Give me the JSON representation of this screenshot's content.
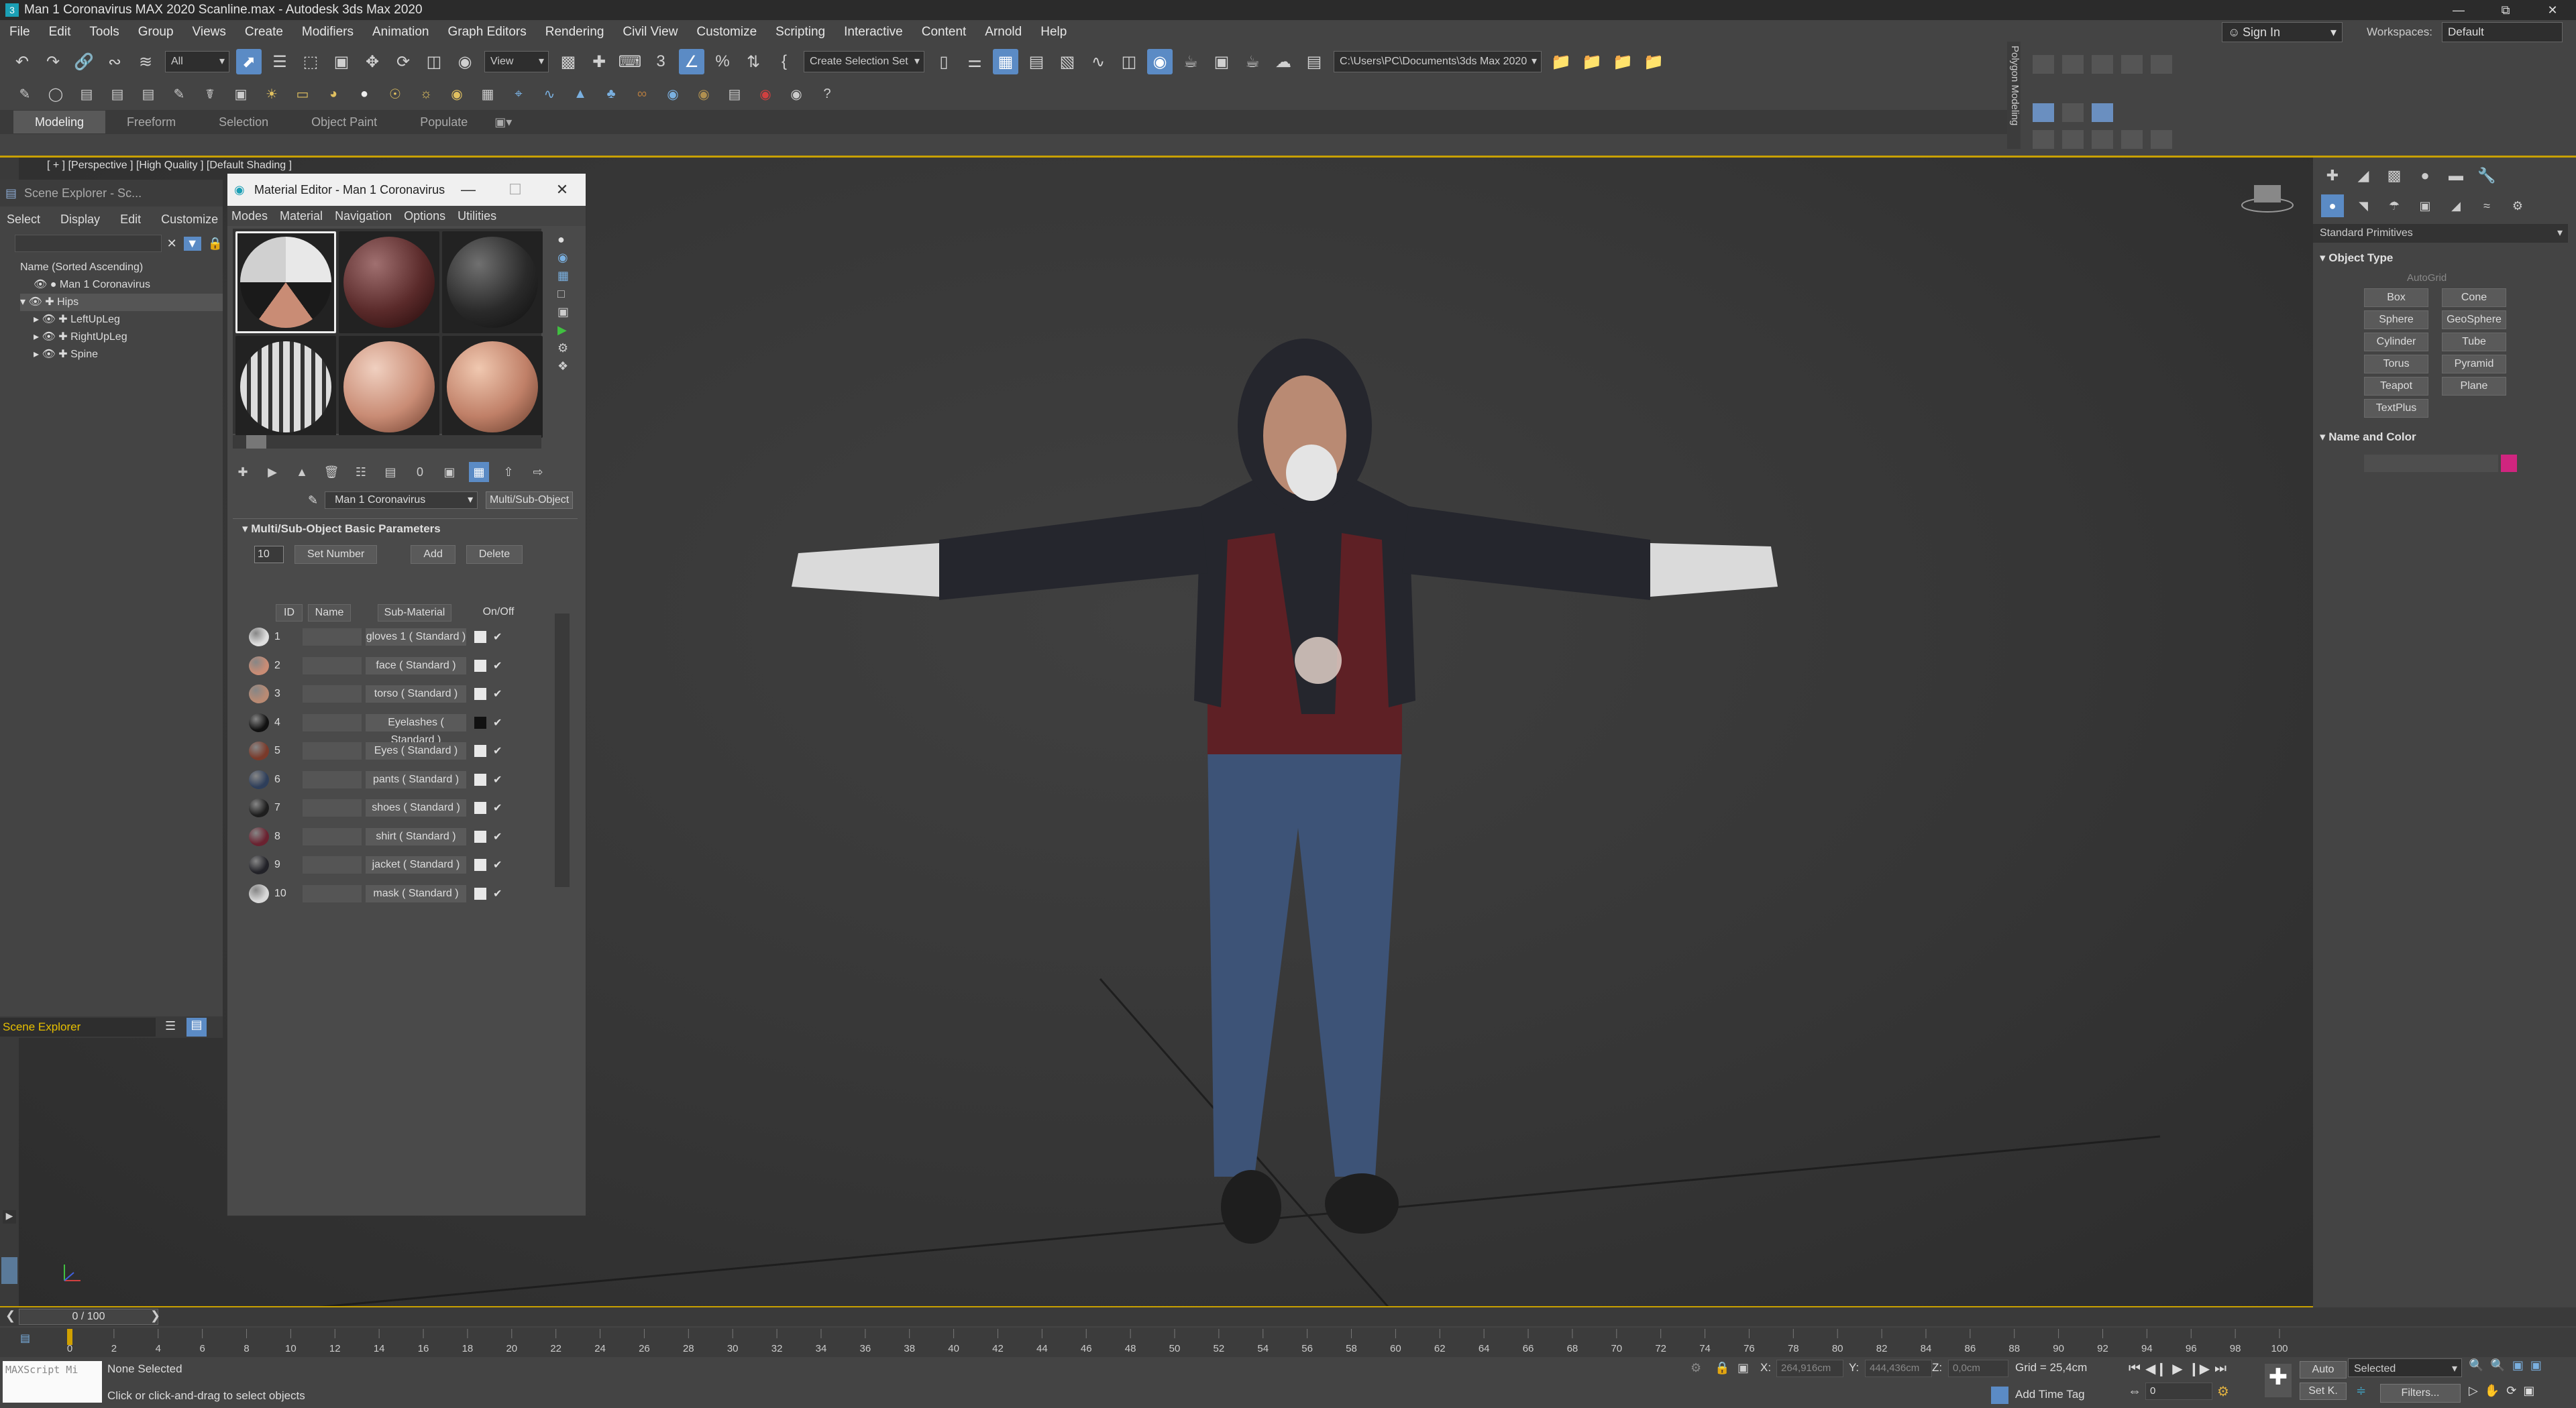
{
  "app": {
    "title": "Man 1 Coronavirus MAX 2020 Scanline.max - Autodesk 3ds Max 2020"
  },
  "menubar": {
    "items": [
      "File",
      "Edit",
      "Tools",
      "Group",
      "Views",
      "Create",
      "Modifiers",
      "Animation",
      "Graph Editors",
      "Rendering",
      "Civil View",
      "Customize",
      "Scripting",
      "Interactive",
      "Content",
      "Arnold",
      "Help"
    ],
    "sign_in": "Sign In",
    "workspaces_label": "Workspaces:",
    "workspaces_value": "Default"
  },
  "toolbar": {
    "selection_filter": "All",
    "ref_coord": "View",
    "selection_set": "Create Selection Set",
    "project_path": "C:\\Users\\PC\\Documents\\3ds Max 2020"
  },
  "ribbon": {
    "tabs": [
      "Modeling",
      "Freeform",
      "Selection",
      "Object Paint",
      "Populate"
    ],
    "polygon_modeling": "Polygon Modeling"
  },
  "viewport": {
    "label": "[ + ] [Perspective ] [High Quality ] [Default Shading ]"
  },
  "scene_explorer": {
    "title": "Scene Explorer - Sc...",
    "menu": [
      "Select",
      "Display",
      "Edit",
      "Customize"
    ],
    "column_header": "Name (Sorted Ascending)",
    "tree": [
      "Man 1 Coronavirus",
      "Hips",
      "LeftUpLeg",
      "RightUpLeg",
      "Spine"
    ],
    "footer_select": "Scene Explorer"
  },
  "material_editor": {
    "title": "Material Editor - Man 1 Coronavirus",
    "menu": [
      "Modes",
      "Material",
      "Navigation",
      "Options",
      "Utilities"
    ],
    "material_name": "Man 1 Coronavirus",
    "material_type": "Multi/Sub-Object",
    "rollout_title": "Multi/Sub-Object Basic Parameters",
    "set_number_value": "10",
    "buttons": {
      "set_number": "Set Number",
      "add": "Add",
      "delete": "Delete"
    },
    "headers": {
      "id": "ID",
      "name": "Name",
      "sub": "Sub-Material",
      "onoff": "On/Off"
    },
    "rows": [
      {
        "id": "1",
        "sub": "gloves 1  ( Standard )",
        "color": "#dedede"
      },
      {
        "id": "2",
        "sub": "face  ( Standard )",
        "color": "#c98c75"
      },
      {
        "id": "3",
        "sub": "torso  ( Standard )",
        "color": "#b98a73"
      },
      {
        "id": "4",
        "sub": "Eyelashes  ( Standard )",
        "color": "#111111"
      },
      {
        "id": "5",
        "sub": "Eyes  ( Standard )",
        "color": "#7a3a2a"
      },
      {
        "id": "6",
        "sub": "pants  ( Standard )",
        "color": "#2e3e5a"
      },
      {
        "id": "7",
        "sub": "shoes  ( Standard )",
        "color": "#1e1e1e"
      },
      {
        "id": "8",
        "sub": "shirt  ( Standard )",
        "color": "#6a2230"
      },
      {
        "id": "9",
        "sub": "jacket  ( Standard )",
        "color": "#222228"
      },
      {
        "id": "10",
        "sub": "mask  ( Standard )",
        "color": "#d8d8d8"
      }
    ]
  },
  "command_panel": {
    "category": "Standard Primitives",
    "object_type": "Object Type",
    "autogrid": "AutoGrid",
    "primitives": [
      "Box",
      "Cone",
      "Sphere",
      "GeoSphere",
      "Cylinder",
      "Tube",
      "Torus",
      "Pyramid",
      "Teapot",
      "Plane",
      "TextPlus"
    ],
    "name_and_color": "Name and Color",
    "object_color": "#d0257f"
  },
  "timeline": {
    "frame_display": "0 / 100",
    "ticks": [
      "0",
      "2",
      "4",
      "6",
      "8",
      "10",
      "12",
      "14",
      "16",
      "18",
      "20",
      "22",
      "24",
      "26",
      "28",
      "30",
      "32",
      "34",
      "36",
      "38",
      "40",
      "42",
      "44",
      "46",
      "48",
      "50",
      "52",
      "54",
      "56",
      "58",
      "60",
      "62",
      "64",
      "66",
      "68",
      "70",
      "72",
      "74",
      "76",
      "78",
      "80",
      "82",
      "84",
      "86",
      "88",
      "90",
      "92",
      "94",
      "96",
      "98",
      "100"
    ]
  },
  "status": {
    "maxscript": "MAXScript Mi",
    "line1": "None Selected",
    "line2": "Click or click-and-drag to select objects",
    "x_label": "X:",
    "x_value": "264,916cm",
    "y_label": "Y:",
    "y_value": "444,436cm",
    "z_label": "Z:",
    "z_value": "0,0cm",
    "grid": "Grid = 25,4cm",
    "add_time_tag": "Add Time Tag",
    "auto": "Auto",
    "set_k": "Set K.",
    "key_mode": "Selected",
    "filters": "Filters...",
    "frame_value": "0"
  }
}
